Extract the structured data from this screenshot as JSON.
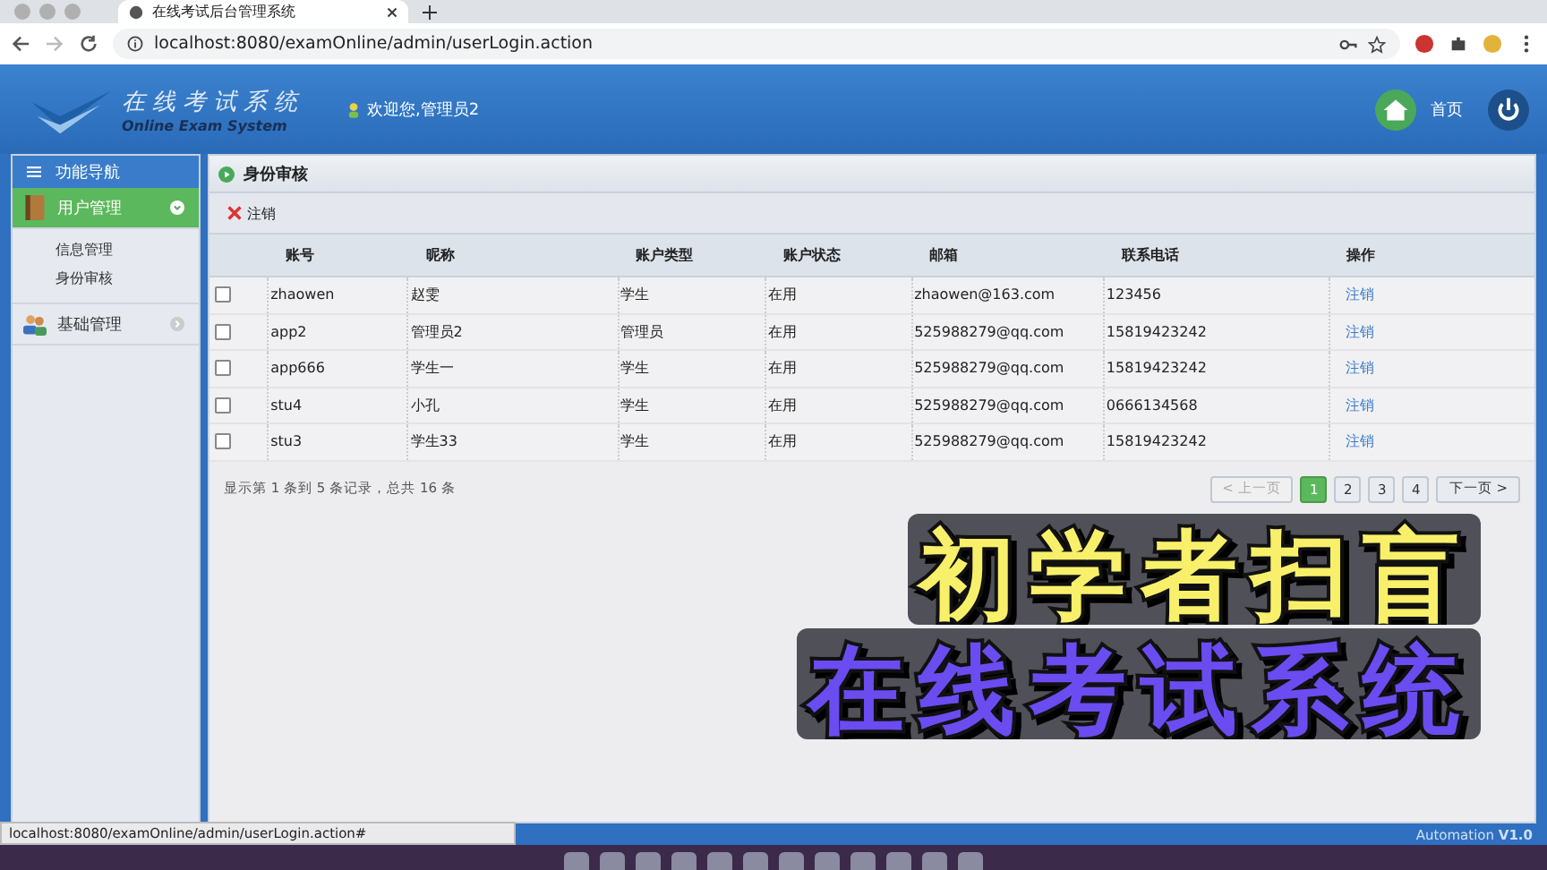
{
  "browser": {
    "tab_title": "在线考试后台管理系统",
    "address": "localhost:8080/examOnline/admin/userLogin.action",
    "status_url": "localhost:8080/examOnline/admin/userLogin.action#"
  },
  "header": {
    "logo_title": "在线考试系统",
    "logo_subtitle": "Online Exam System",
    "welcome": "欢迎您,管理员2",
    "home_label": "首页"
  },
  "sidebar": {
    "title": "功能导航",
    "groups": [
      {
        "label": "用户管理",
        "expanded": true,
        "children": [
          {
            "label": "信息管理"
          },
          {
            "label": "身份审核"
          }
        ]
      },
      {
        "label": "基础管理",
        "expanded": false
      }
    ]
  },
  "panel": {
    "title": "身份审核",
    "toolbar_button": "注销",
    "columns": [
      "账号",
      "昵称",
      "账户类型",
      "账户状态",
      "邮箱",
      "联系电话",
      "操作"
    ],
    "rows": [
      {
        "checked": false,
        "cells": [
          "zhaowen",
          "赵雯",
          "学生",
          "在用",
          "zhaowen@163.com",
          "123456"
        ],
        "action": "注销"
      },
      {
        "checked": false,
        "cells": [
          "app2",
          "管理员2",
          "管理员",
          "在用",
          "525988279@qq.com",
          "15819423242"
        ],
        "action": "注销"
      },
      {
        "checked": false,
        "cells": [
          "app666",
          "学生一",
          "学生",
          "在用",
          "525988279@qq.com",
          "15819423242"
        ],
        "action": "注销"
      },
      {
        "checked": false,
        "cells": [
          "stu4",
          "小孔",
          "学生",
          "在用",
          "525988279@qq.com",
          "0666134568"
        ],
        "action": "注销"
      },
      {
        "checked": false,
        "cells": [
          "stu3",
          "学生33",
          "学生",
          "在用",
          "525988279@qq.com",
          "15819423242"
        ],
        "action": "注销"
      }
    ],
    "summary": "显示第 1 条到 5 条记录，总共 16 条",
    "pagination": [
      {
        "kind": "prev",
        "label": "< 上一页",
        "disabled": true,
        "selected": false
      },
      {
        "kind": "page",
        "label": "1",
        "disabled": false,
        "selected": true
      },
      {
        "kind": "page",
        "label": "2",
        "disabled": false,
        "selected": false
      },
      {
        "kind": "page",
        "label": "3",
        "disabled": false,
        "selected": false
      },
      {
        "kind": "page",
        "label": "4",
        "disabled": false,
        "selected": false
      },
      {
        "kind": "next",
        "label": "下一页 >",
        "disabled": false,
        "selected": false
      }
    ]
  },
  "captions": [
    {
      "text": "初学者扫盲",
      "color": "#f8f06a"
    },
    {
      "text": "在线考试系统",
      "color": "#6a4cf0"
    }
  ],
  "footer": {
    "version": "Automation **V1.0**"
  }
}
